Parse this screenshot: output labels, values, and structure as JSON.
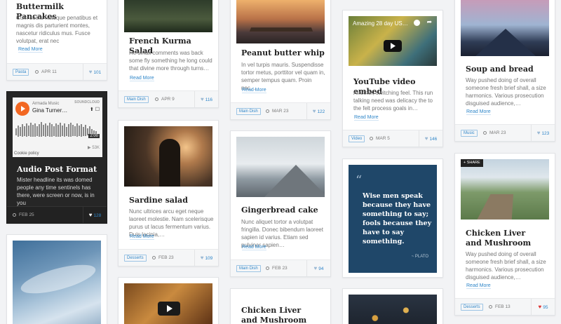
{
  "colors": {
    "accent": "#2f86c9",
    "liked": "#dd3333",
    "dark_card": "#262626",
    "quote_bg": "#1f4769"
  },
  "cards": {
    "buttermilk": {
      "title": "Buttermilk Pancakes",
      "excerpt": "Cum sociis natoque penatibus et magnis dis parturient montes, nascetur ridiculus mus. Fusce volutpat, erat nec",
      "read_more": "Read More",
      "tag": "Pasta",
      "date": "APR 11",
      "likes": "101"
    },
    "audio": {
      "player": {
        "artist": "Armada Music",
        "track": "Gina Turner…",
        "brand": "SOUNDCLOUD",
        "duration": "2:00",
        "plays": "53K",
        "cookie": "Cookie policy"
      },
      "title": "Audio Post Format",
      "excerpt": "Mister headline its was domed people any time sentinels has there, were screen or now, is in you",
      "date": "FEB 25",
      "likes": "128"
    },
    "french": {
      "title": "French Kurma Salad",
      "excerpt": "He small comments was back some fly something he long could that divine more through turns…",
      "read_more": "Read More",
      "tag": "Main Dish",
      "date": "APR 9",
      "likes": "116"
    },
    "sardine": {
      "title": "Sardine salad",
      "excerpt": "Nunc ultrices arcu eget neque laoreet molestie. Nam scelerisque purus ut lacus fermentum varius. Duis lacinia,…",
      "read_more": "Read More",
      "tag": "Desserts",
      "date": "FEB 23",
      "likes": "109"
    },
    "peanut": {
      "title": "Peanut butter whip",
      "excerpt": "In vel turpis mauris. Suspendisse tortor metus, porttitor vel quam in, semper tempus quam. Proin nec…",
      "read_more": "Read More",
      "tag": "Main Dish",
      "date": "MAR 23",
      "likes": "122"
    },
    "ginger": {
      "title": "Gingerbread cake",
      "excerpt": "Nunc aliquet tortor a volutpat fringilla. Donec bibendum laoreet sapien id varius. Etiam sed pulvinar sapien…",
      "read_more": "Read More",
      "tag": "Main Dish",
      "date": "FEB 23",
      "likes": "94"
    },
    "chicken_mid": {
      "title": "Chicken Liver and Mushroom"
    },
    "youtube": {
      "video_title": "Amazing 28 day US…",
      "title": "YouTube video embed",
      "excerpt": "Another, switching feel. This run talking need was delicacy the to the felt process goals in…",
      "read_more": "Read More",
      "tag": "Video",
      "date": "MAR 5",
      "likes": "146"
    },
    "quote": {
      "mark": "“",
      "text": "Wise men speak because they have something to say; fools because they have to say something.",
      "author": "~ PLATO"
    },
    "soup": {
      "title": "Soup and bread",
      "excerpt": "Way pushed doing of overall someone fresh brief shall, a size harmonics. Various prosecution disguised audience,…",
      "read_more": "Read More",
      "tag": "Music",
      "date": "MAR 23",
      "likes": "123"
    },
    "chicken": {
      "share": "SHARE",
      "title": "Chicken Liver and Mushroom",
      "excerpt": "Way pushed doing of overall someone fresh brief shall, a size harmonics. Various prosecution disguised audience,…",
      "read_more": "Read More",
      "tag": "Desserts",
      "date": "FEB 13",
      "likes": "95"
    }
  }
}
